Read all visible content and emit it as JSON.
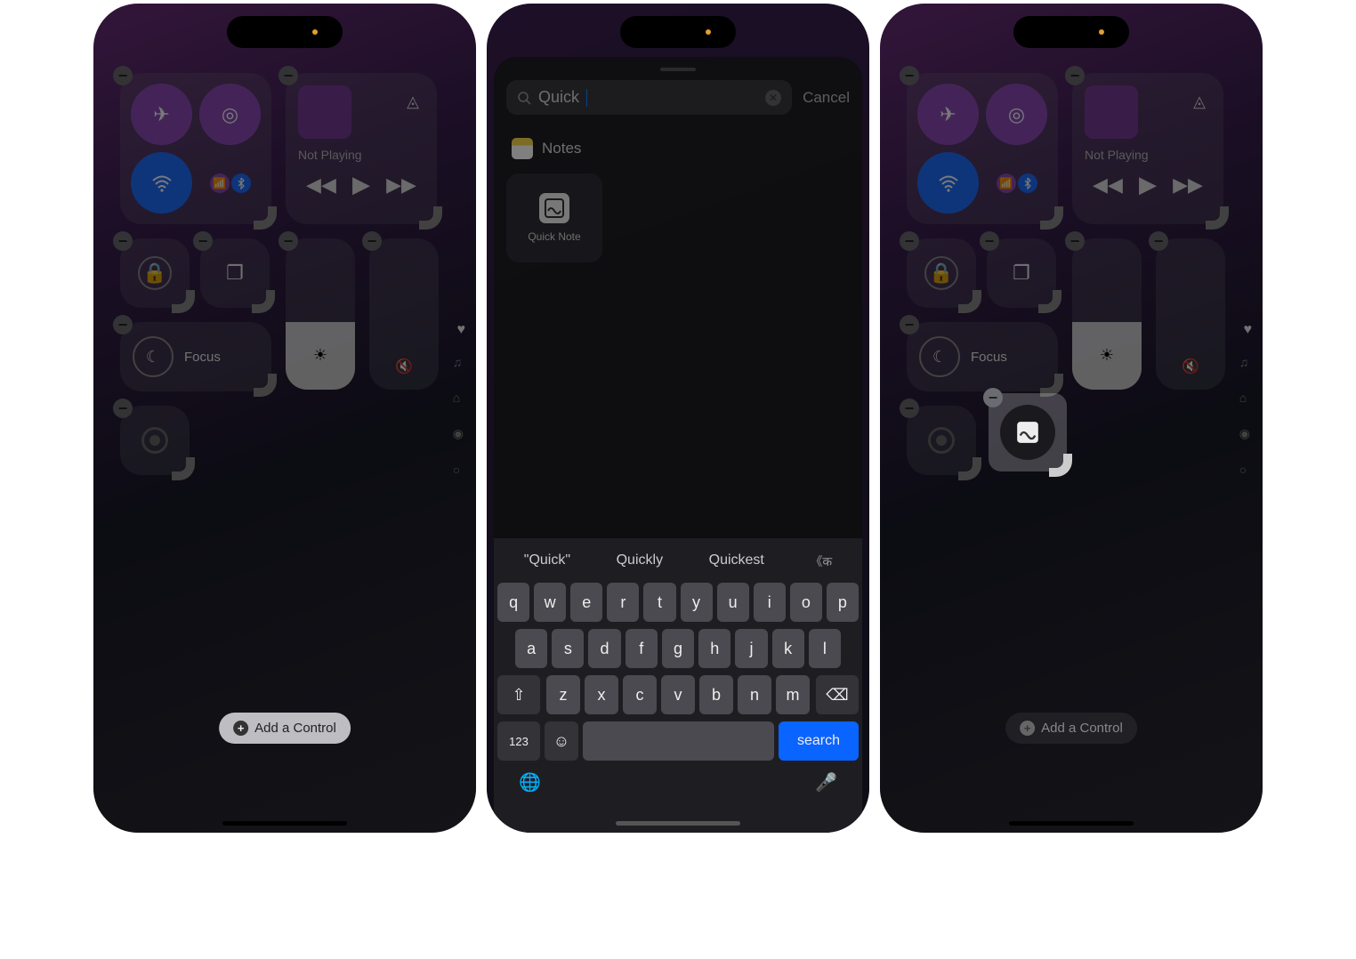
{
  "panel1": {
    "media": {
      "not_playing": "Not Playing"
    },
    "focus": {
      "label": "Focus"
    },
    "add_control": "Add a Control"
  },
  "panel2": {
    "search": {
      "value": "Quick",
      "cancel": "Cancel"
    },
    "section": {
      "app": "Notes",
      "result": "Quick Note"
    },
    "suggestions": [
      "\"Quick\"",
      "Quickly",
      "Quickest",
      "《क"
    ],
    "keyboard": {
      "row1": [
        "q",
        "w",
        "e",
        "r",
        "t",
        "y",
        "u",
        "i",
        "o",
        "p"
      ],
      "row2": [
        "a",
        "s",
        "d",
        "f",
        "g",
        "h",
        "j",
        "k",
        "l"
      ],
      "row3": [
        "z",
        "x",
        "c",
        "v",
        "b",
        "n",
        "m"
      ],
      "num": "123",
      "search": "search"
    }
  },
  "panel3": {
    "media": {
      "not_playing": "Not Playing"
    },
    "focus": {
      "label": "Focus"
    },
    "add_control": "Add a Control"
  }
}
